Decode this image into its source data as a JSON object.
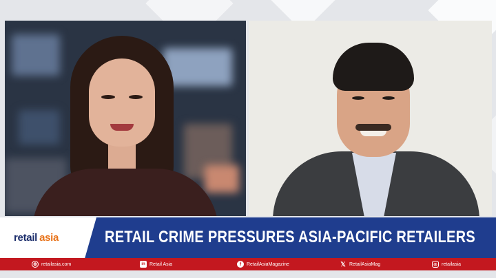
{
  "brand": {
    "logo_retail": "retail",
    "logo_asia": "asia",
    "colors": {
      "navy": "#1f3d8e",
      "red": "#c3181f",
      "orange": "#e8731a"
    }
  },
  "headline": "RETAIL CRIME PRESSURES ASIA-PACIFIC RETAILERS",
  "social": [
    {
      "icon": "web-globe-icon",
      "glyph": "⊕",
      "label": "retailasia.com"
    },
    {
      "icon": "linkedin-icon",
      "glyph": "in",
      "label": "Retail Asia"
    },
    {
      "icon": "facebook-icon",
      "glyph": "f",
      "label": "RetailAsiaMagazine"
    },
    {
      "icon": "x-twitter-icon",
      "glyph": "𝕏",
      "label": "RetailAsiaMag"
    },
    {
      "icon": "instagram-icon",
      "glyph": "◎",
      "label": "retailasia"
    }
  ]
}
